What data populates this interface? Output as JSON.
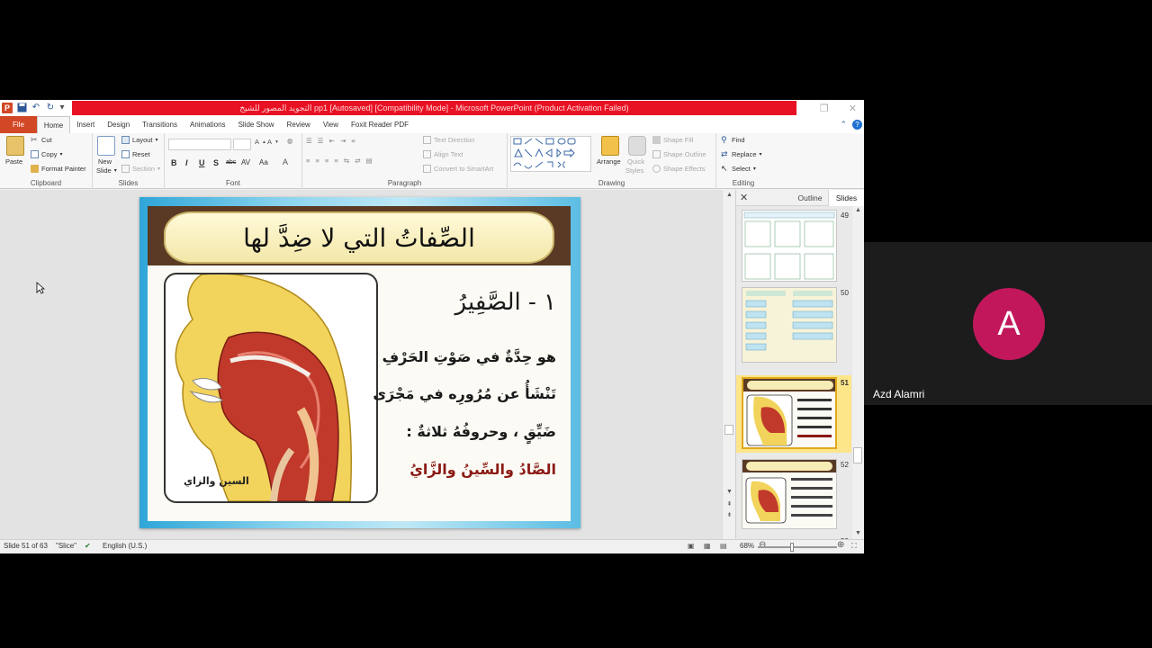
{
  "window": {
    "title": "التجويد المصور للشيخ pp1 [Autosaved] [Compatibility Mode] - Microsoft PowerPoint (Product Activation Failed)",
    "app_icon_letter": "P"
  },
  "tabs": [
    "File",
    "Home",
    "Insert",
    "Design",
    "Transitions",
    "Animations",
    "Slide Show",
    "Review",
    "View",
    "Foxit Reader PDF"
  ],
  "ribbon": {
    "clipboard": {
      "paste": "Paste",
      "cut": "Cut",
      "copy": "Copy",
      "format_painter": "Format Painter",
      "label": "Clipboard"
    },
    "slides": {
      "new_slide_line1": "New",
      "new_slide_line2": "Slide",
      "layout": "Layout",
      "reset": "Reset",
      "section": "Section",
      "label": "Slides"
    },
    "font": {
      "label": "Font",
      "bold": "B",
      "italic": "I",
      "underline": "U",
      "strike": "S",
      "shadow": "abc",
      "spacing": "AV",
      "case": "Aa"
    },
    "paragraph": {
      "text_direction": "Text Direction",
      "align_text": "Align Text",
      "convert_smartart": "Convert to SmartArt",
      "label": "Paragraph"
    },
    "drawing": {
      "arrange": "Arrange",
      "quick_styles_line1": "Quick",
      "quick_styles_line2": "Styles",
      "shape_fill": "Shape Fill",
      "shape_outline": "Shape Outline",
      "shape_effects": "Shape Effects",
      "label": "Drawing"
    },
    "editing": {
      "find": "Find",
      "replace": "Replace",
      "select": "Select",
      "label": "Editing"
    }
  },
  "slide": {
    "banner_title": "الصِّفاتُ التي لا ضِدَّ لها",
    "heading": "١ - الصَّفِيرُ",
    "line1": "هو حِدَّةٌ في صَوْتِ الحَرْفِ",
    "line2": "تَنْشَأُ عن مُرُورِه في مَجْرَى",
    "line3": "ضَيِّقٍ ، وحروفُهُ ثلاثةٌ :",
    "line4": "الصَّادُ والسِّينُ والزَّايُ",
    "image_caption": "السين والزاي"
  },
  "side_panel": {
    "outline_tab": "Outline",
    "slides_tab": "Slides",
    "thumbnails": [
      {
        "number": "49",
        "selected": false
      },
      {
        "number": "50",
        "selected": false
      },
      {
        "number": "51",
        "selected": true
      },
      {
        "number": "52",
        "selected": false
      },
      {
        "number": "53",
        "selected": false
      }
    ]
  },
  "status": {
    "slide_info": "Slide 51 of 63",
    "theme": "\"Slice\"",
    "language": "English (U.S.)",
    "zoom": "68%"
  },
  "participant": {
    "initial": "A",
    "name": "Azd Alamri",
    "avatar_color": "#c2185b"
  },
  "colors": {
    "title_bar_red": "#e81123",
    "file_tab": "#d24726",
    "selected_thumb": "#fde58a"
  }
}
